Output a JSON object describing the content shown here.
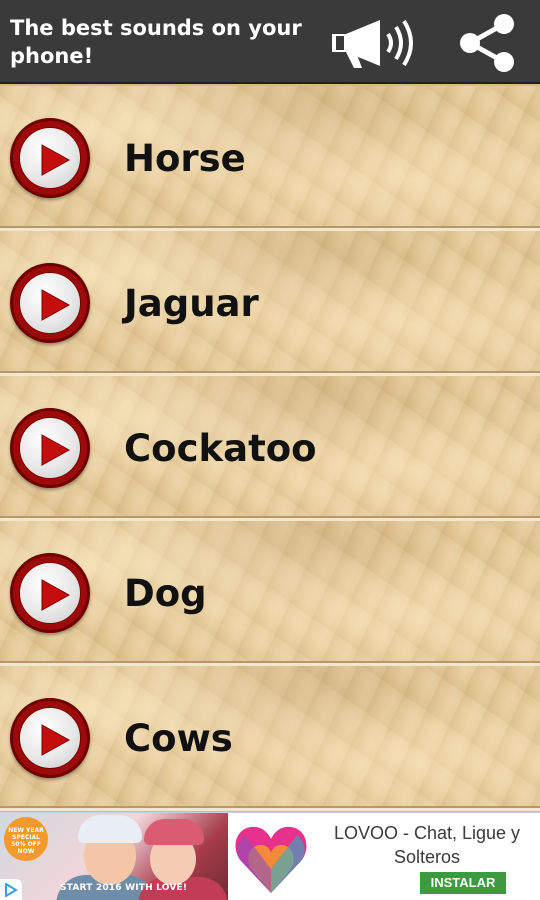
{
  "header": {
    "title": "The best sounds on your phone!",
    "icons": {
      "volume": "megaphone-icon",
      "share": "share-icon"
    }
  },
  "sounds": [
    {
      "label": "Horse"
    },
    {
      "label": "Jaguar"
    },
    {
      "label": "Cockatoo"
    },
    {
      "label": "Dog"
    },
    {
      "label": "Cows"
    }
  ],
  "ad": {
    "badge_text": "NEW YEAR SPECIAL 50% OFF NOW",
    "tagline": "START 2016 WITH LOVE!",
    "app_title": "LOVOO - Chat, Ligue y Solteros",
    "install_label": "INSTALAR"
  },
  "colors": {
    "header_bg": "#3a3a3a",
    "play_ring": "#9c0a0a",
    "play_triangle": "#c40d0d",
    "install_green": "#3c9a40"
  }
}
